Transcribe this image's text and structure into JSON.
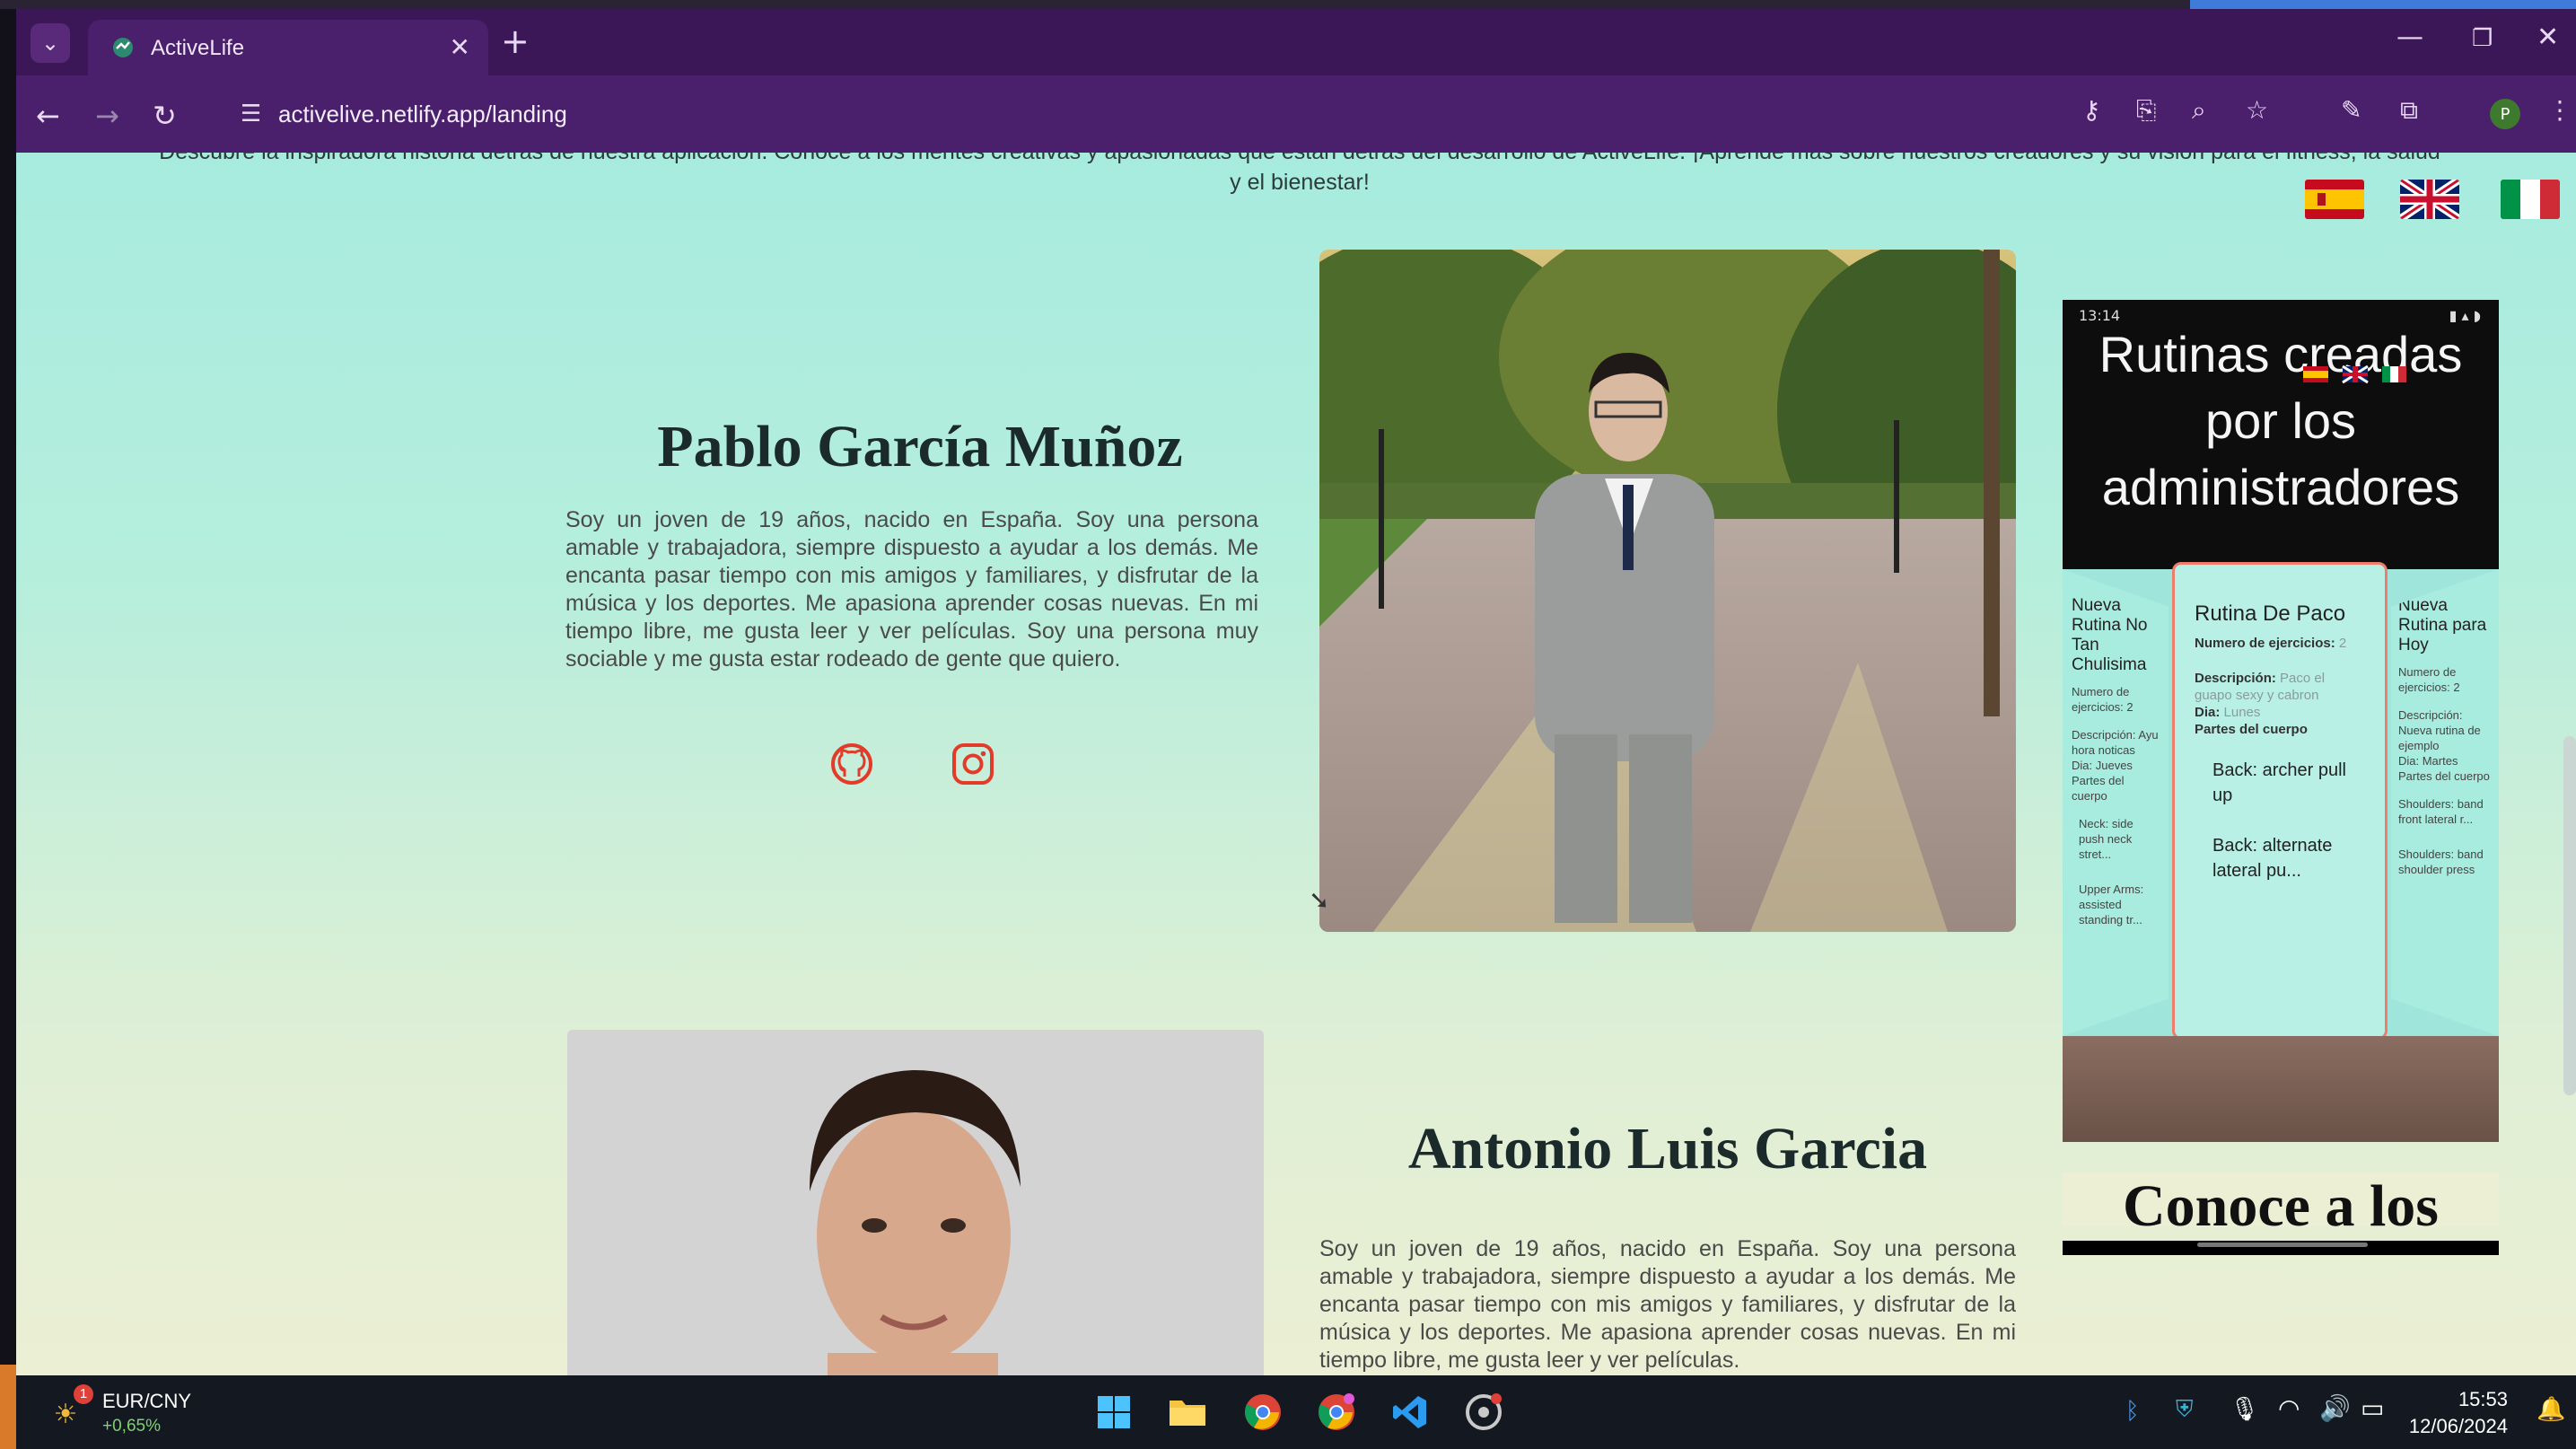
{
  "browser": {
    "tab_title": "ActiveLife",
    "tab_close": "✕",
    "new_tab": "+",
    "url": "activelive.netlify.app/landing"
  },
  "page": {
    "intro_line1": "Descubre la inspiradora historia detrás de nuestra aplicación. Conoce a los mentes creativas y apasionadas que están detrás del desarrollo de ActiveLife. ¡Aprende más sobre nuestros creadores y su visión para el fitness, la salud",
    "intro_line2": "y el bienestar!",
    "flags": [
      "es",
      "gb",
      "it"
    ],
    "profiles": [
      {
        "name": "Pablo García Muñoz",
        "bio": "Soy un joven de 19 años, nacido en España. Soy una persona amable y trabajadora, siempre dispuesto a ayudar a los demás. Me encanta pasar tiempo con mis amigos y familiares, y disfrutar de la música y los deportes. Me apasiona aprender cosas nuevas. En mi tiempo libre, me gusta leer y ver películas. Soy una persona muy sociable y me gusta estar rodeado de gente que quiero."
      },
      {
        "name": "Antonio Luis Garcia",
        "bio": "Soy un joven de 19 años, nacido en España. Soy una persona amable y trabajadora, siempre dispuesto a ayudar a los demás. Me encanta pasar tiempo con mis amigos y familiares, y disfrutar de la música y los deportes. Me apasiona aprender cosas nuevas. En mi tiempo libre, me gusta leer y ver películas."
      }
    ],
    "phone": {
      "status_time": "13:14",
      "heading": "Rutinas creadas por los administradores",
      "main_card": {
        "title": "Rutina De Paco",
        "ex_count_label": "Numero de ejercicios:",
        "ex_count": "2",
        "desc_label": "Descripción:",
        "desc": "Paco el guapo sexy y cabron",
        "day_label": "Dia:",
        "day": "Lunes",
        "parts_label": "Partes del cuerpo",
        "exercises": [
          "Back: archer pull up",
          "Back: alternate lateral pu..."
        ]
      },
      "left_card": {
        "title": "Nueva Rutina No Tan Chulisima",
        "line1": "Numero de ejercicios: 2",
        "line2": "Descripción: Ayu hora noticas",
        "line3": "Dia: Jueves",
        "line4": "Partes del cuerpo",
        "ex1": "Neck: side push neck stret...",
        "ex2": "Upper Arms: assisted standing tr..."
      },
      "right_card": {
        "title": "Nueva Rutina para Hoy",
        "line1": "Numero de ejercicios: 2",
        "line2": "Descripción: Nueva rutina de ejemplo",
        "line3": "Dia: Martes",
        "line4": "Partes del cuerpo",
        "ex1": "Shoulders: band front lateral r...",
        "ex2": "Shoulders: band shoulder press"
      }
    },
    "conoce": "Conoce a los"
  },
  "taskbar": {
    "ticker_name": "EUR/CNY",
    "ticker_change": "+0,65%",
    "badge": "1",
    "time": "15:53",
    "date": "12/06/2024"
  }
}
